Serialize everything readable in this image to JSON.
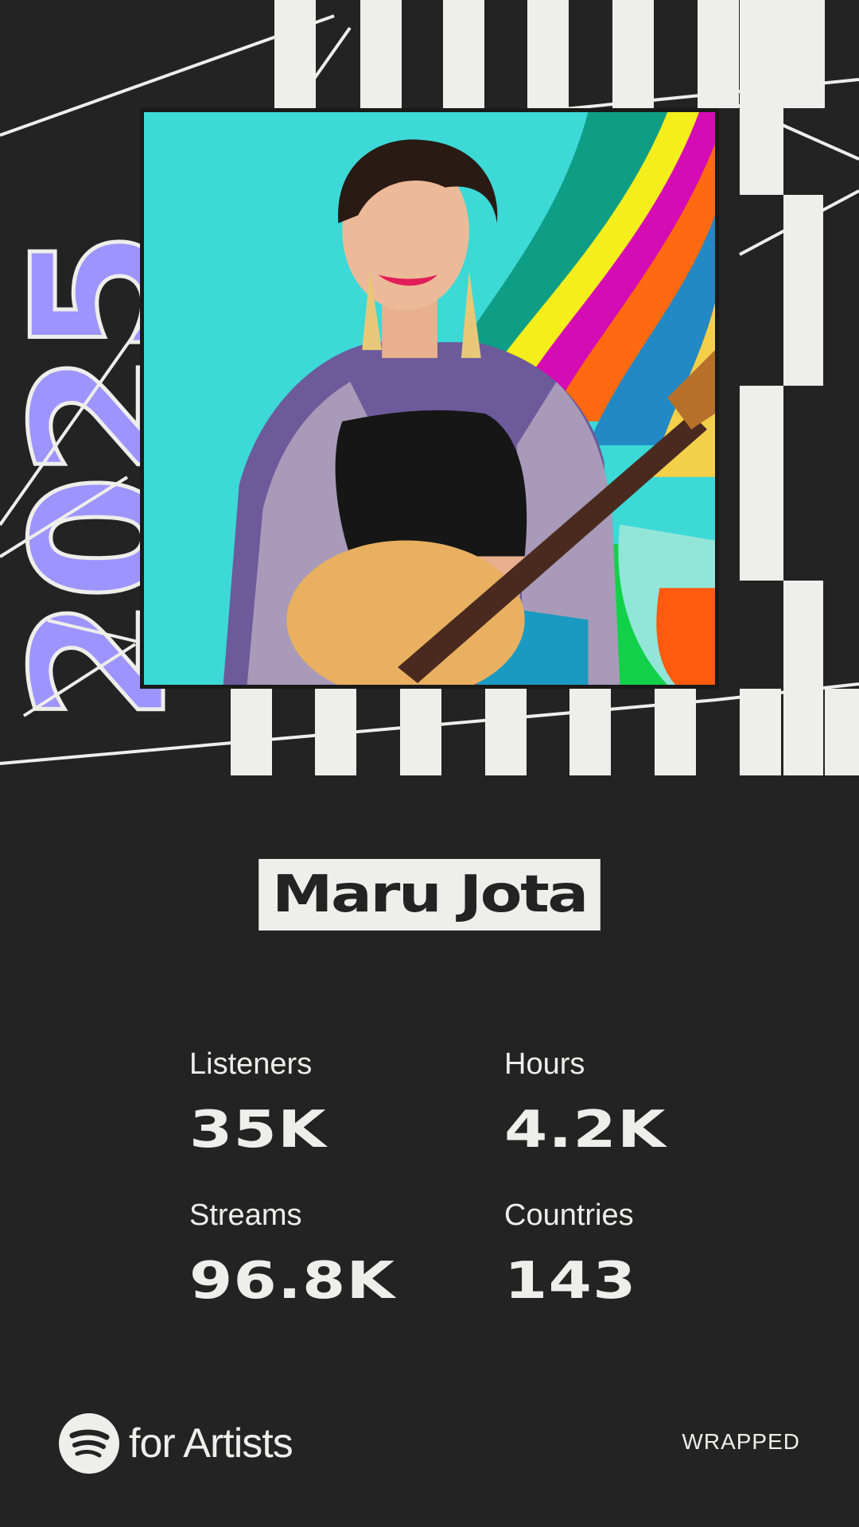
{
  "banner": {
    "year": "2025",
    "year_color": "#9e94ff",
    "photo_description_icon": "artist-portrait-photo"
  },
  "artist": {
    "name": "Maru Jota"
  },
  "stats": [
    {
      "label": "Listeners",
      "value": "35K"
    },
    {
      "label": "Hours",
      "value": "4.2K"
    },
    {
      "label": "Streams",
      "value": "96.8K"
    },
    {
      "label": "Countries",
      "value": "143"
    }
  ],
  "footer": {
    "logo_icon": "spotify-logo-icon",
    "brand": "for Artists",
    "tag": "WRAPPED"
  },
  "colors": {
    "background": "#232323",
    "foreground": "#eeeeea",
    "accent": "#9e94ff"
  }
}
